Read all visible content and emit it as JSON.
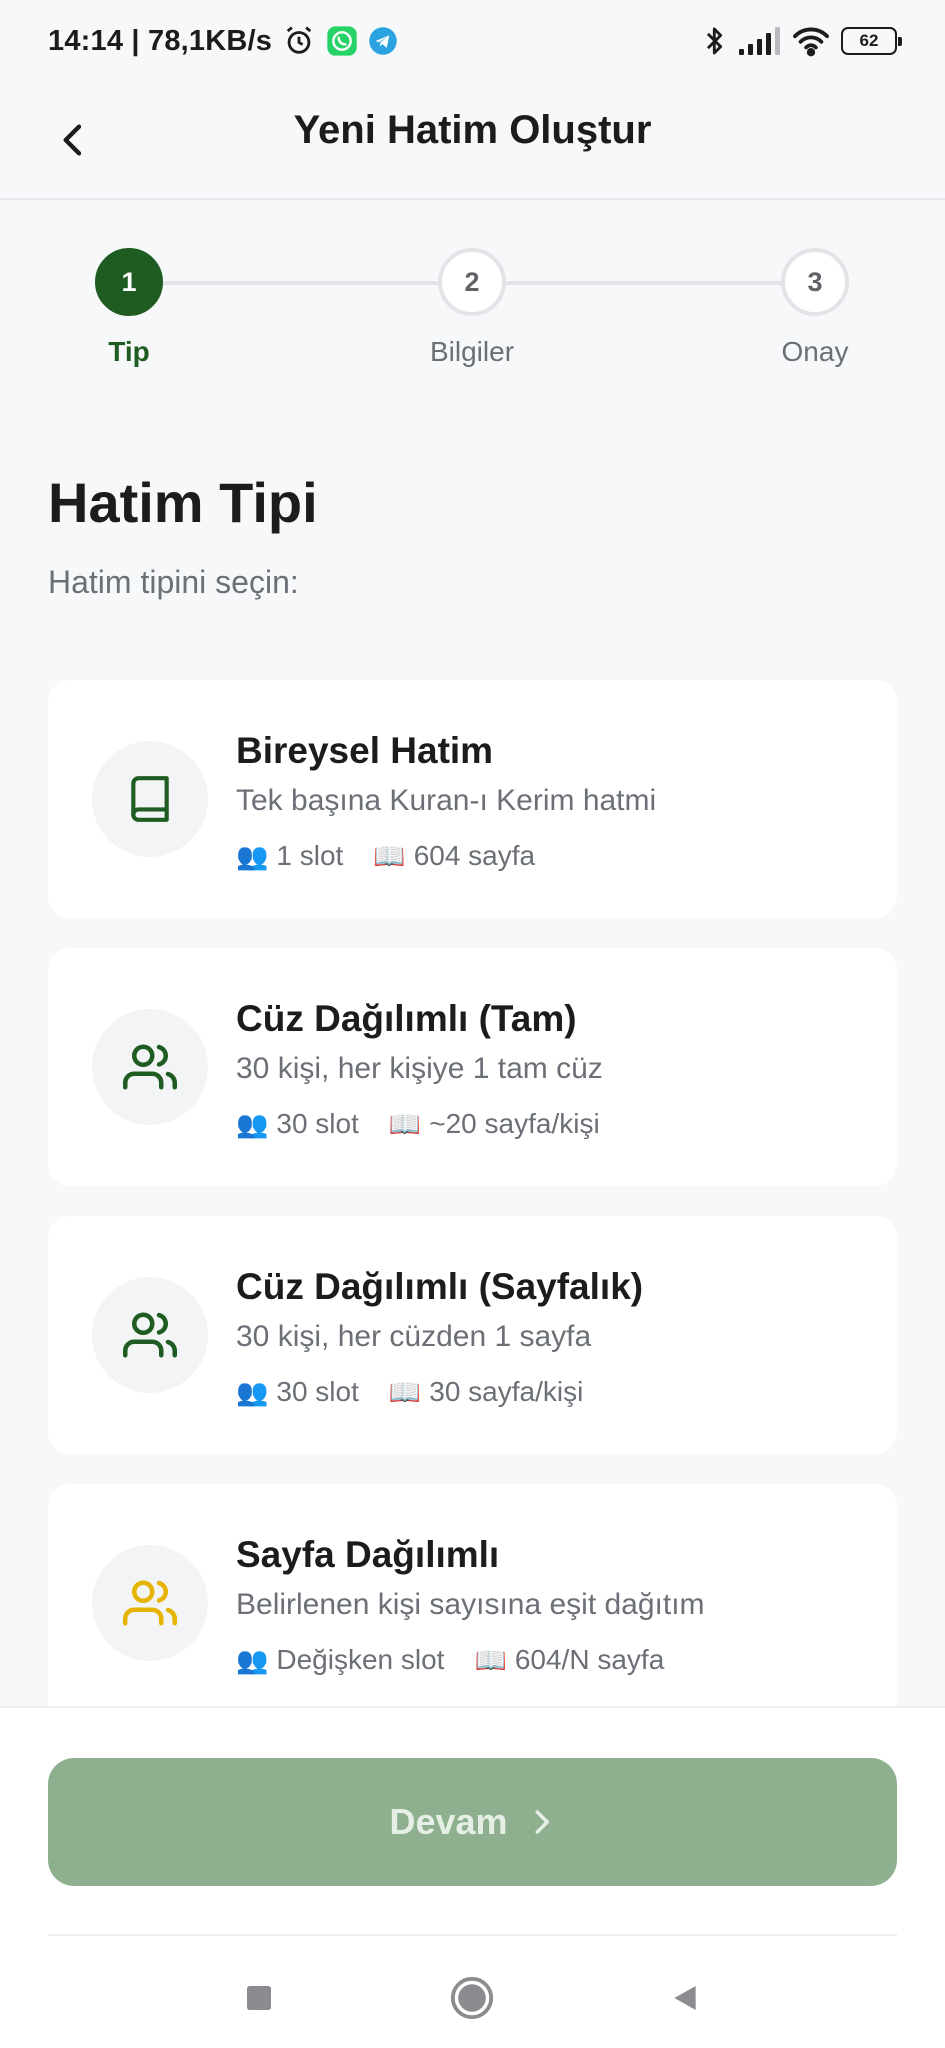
{
  "status_bar": {
    "time_speed": "14:14 | 78,1KB/s",
    "battery": "62"
  },
  "header": {
    "title": "Yeni Hatim Oluştur"
  },
  "stepper": {
    "steps": [
      {
        "number": "1",
        "label": "Tip",
        "active": true
      },
      {
        "number": "2",
        "label": "Bilgiler",
        "active": false
      },
      {
        "number": "3",
        "label": "Onay",
        "active": false
      }
    ]
  },
  "content": {
    "title": "Hatim Tipi",
    "subtitle": "Hatim tipini seçin:"
  },
  "cards": [
    {
      "title": "Bireysel Hatim",
      "desc": "Tek başına Kuran-ı Kerim hatmi",
      "slots": "1 slot",
      "pages": "604 sayfa",
      "icon": "book-icon",
      "icon_color": "#1e5c22"
    },
    {
      "title": "Cüz Dağılımlı (Tam)",
      "desc": "30 kişi, her kişiye 1 tam cüz",
      "slots": "30 slot",
      "pages": "~20 sayfa/kişi",
      "icon": "users-icon",
      "icon_color": "#1e5c22"
    },
    {
      "title": "Cüz Dağılımlı (Sayfalık)",
      "desc": "30 kişi, her cüzden 1 sayfa",
      "slots": "30 slot",
      "pages": "30 sayfa/kişi",
      "icon": "users-icon",
      "icon_color": "#1e5c22"
    },
    {
      "title": "Sayfa Dağılımlı",
      "desc": "Belirlenen kişi sayısına eşit dağıtım",
      "slots": "Değişken slot",
      "pages": "604/N sayfa",
      "icon": "users-icon",
      "icon_color": "#e6b400"
    }
  ],
  "footer": {
    "continue_label": "Devam"
  },
  "colors": {
    "accent": "#1e5c22",
    "button_disabled": "#8fb08f"
  }
}
